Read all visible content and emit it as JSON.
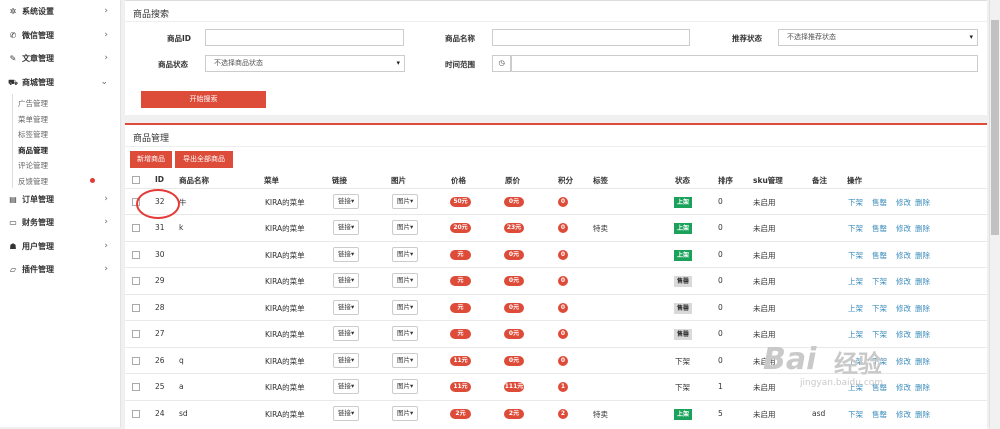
{
  "sidebar": {
    "menus": [
      {
        "label": "系统设置",
        "icon": "gears-icon"
      },
      {
        "label": "微信管理",
        "icon": "wechat-icon"
      },
      {
        "label": "文章管理",
        "icon": "edit-icon"
      },
      {
        "label": "商城管理",
        "icon": "cart-icon"
      },
      {
        "label": "订单管理",
        "icon": "order-icon"
      },
      {
        "label": "财务管理",
        "icon": "card-icon"
      },
      {
        "label": "用户管理",
        "icon": "users-icon"
      },
      {
        "label": "插件管理",
        "icon": "plugin-icon"
      }
    ],
    "submenu": [
      "广告管理",
      "菜单管理",
      "标签管理",
      "商品管理",
      "评论管理",
      "反馈管理"
    ],
    "active_sub": "商品管理"
  },
  "search": {
    "title": "商品搜索",
    "id_label": "商品ID",
    "name_label": "商品名称",
    "recommend_label": "推荐状态",
    "recommend_placeholder": "不选择推荐状态",
    "status_label": "商品状态",
    "status_placeholder": "不选择商品状态",
    "time_label": "时间范围",
    "submit": "开始搜索"
  },
  "manage": {
    "title": "商品管理",
    "add_button": "新增商品",
    "export_button": "导出全部商品"
  },
  "table": {
    "columns": [
      "ID",
      "商品名称",
      "菜单",
      "链接",
      "图片",
      "价格",
      "原价",
      "积分",
      "标签",
      "状态",
      "排序",
      "sku管理",
      "备注",
      "操作"
    ],
    "link_btn": "链接",
    "image_btn": "图片",
    "sku_value": "未启用",
    "actions": {
      "down": "下架",
      "sold": "售罄",
      "edit": "修改",
      "delete": "删除",
      "up": "上架"
    },
    "rows": [
      {
        "id": "32",
        "name": "牛",
        "menu": "KIRA的菜单",
        "price": "50元",
        "orig": "0元",
        "points": "0",
        "tag": "",
        "status": "上架",
        "status_type": "on",
        "sort": "0",
        "note": "",
        "actions": [
          "down",
          "sold",
          "edit",
          "delete"
        ]
      },
      {
        "id": "31",
        "name": "k",
        "menu": "KIRA的菜单",
        "price": "20元",
        "orig": "23元",
        "points": "0",
        "tag": "特卖",
        "status": "上架",
        "status_type": "on",
        "sort": "0",
        "note": "",
        "actions": [
          "down",
          "sold",
          "edit",
          "delete"
        ]
      },
      {
        "id": "30",
        "name": "",
        "menu": "KIRA的菜单",
        "price": "元",
        "orig": "0元",
        "points": "0",
        "tag": "",
        "status": "上架",
        "status_type": "on",
        "sort": "0",
        "note": "",
        "actions": [
          "down",
          "sold",
          "edit",
          "delete"
        ]
      },
      {
        "id": "29",
        "name": "",
        "menu": "KIRA的菜单",
        "price": "元",
        "orig": "0元",
        "points": "0",
        "tag": "",
        "status": "售罄",
        "status_type": "sold",
        "sort": "0",
        "note": "",
        "actions": [
          "up",
          "down",
          "edit",
          "delete"
        ]
      },
      {
        "id": "28",
        "name": "",
        "menu": "KIRA的菜单",
        "price": "元",
        "orig": "0元",
        "points": "0",
        "tag": "",
        "status": "售罄",
        "status_type": "sold",
        "sort": "0",
        "note": "",
        "actions": [
          "up",
          "down",
          "edit",
          "delete"
        ]
      },
      {
        "id": "27",
        "name": "",
        "menu": "KIRA的菜单",
        "price": "元",
        "orig": "0元",
        "points": "0",
        "tag": "",
        "status": "售罄",
        "status_type": "sold",
        "sort": "0",
        "note": "",
        "actions": [
          "up",
          "down",
          "edit",
          "delete"
        ]
      },
      {
        "id": "26",
        "name": "q",
        "menu": "KIRA的菜单",
        "price": "11元",
        "orig": "0元",
        "points": "0",
        "tag": "",
        "status": "下架",
        "status_type": "off",
        "sort": "0",
        "note": "",
        "actions": [
          "up",
          "down",
          "edit",
          "delete"
        ]
      },
      {
        "id": "25",
        "name": "a",
        "menu": "KIRA的菜单",
        "price": "11元",
        "orig": "111元",
        "points": "1",
        "tag": "",
        "status": "下架",
        "status_type": "off",
        "sort": "1",
        "note": "",
        "actions": [
          "up",
          "sold",
          "edit",
          "delete"
        ]
      },
      {
        "id": "24",
        "name": "sd",
        "menu": "KIRA的菜单",
        "price": "2元",
        "orig": "2元",
        "points": "2",
        "tag": "特卖",
        "status": "上架",
        "status_type": "on",
        "sort": "5",
        "note": "asd",
        "actions": [
          "down",
          "sold",
          "edit",
          "delete"
        ]
      }
    ]
  },
  "watermark": {
    "brand": "Bai",
    "brand2": "经验",
    "url": "jingyan.baidu.com"
  },
  "colors": {
    "accent": "#dd4b39",
    "link": "#3c8dbc",
    "on": "#1aa15a"
  }
}
